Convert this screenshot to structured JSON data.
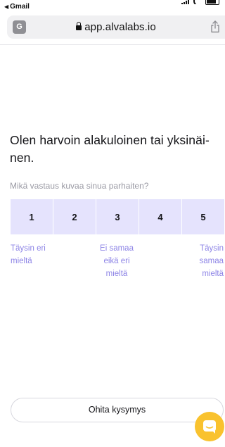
{
  "status_bar": {
    "back_app": "Gmail"
  },
  "browser": {
    "url": "app.alvalabs.io",
    "translate_glyph": "G",
    "icons": [
      "translate-icon",
      "lock-icon",
      "share-icon"
    ]
  },
  "question": {
    "title": "Olen harvoin alakuloinen tai yksinäi­nen.",
    "subtitle": "Mikä vastaus kuvaa sinua parhaiten?"
  },
  "scale": {
    "options": [
      "1",
      "2",
      "3",
      "4",
      "5"
    ],
    "labels": {
      "left": [
        "Täysin eri",
        "mieltä"
      ],
      "middle": [
        "Ei samaa",
        "eikä eri",
        "mieltä"
      ],
      "right": [
        "Täysin",
        "samaa",
        "mieltä"
      ]
    }
  },
  "footer": {
    "skip_label": "Ohita kysymys",
    "chat_icon": "chat-icon"
  },
  "colors": {
    "scale_bg": "#e5e3fd",
    "label_purple": "#8d84e6",
    "chat_button": "#f9c22e"
  }
}
